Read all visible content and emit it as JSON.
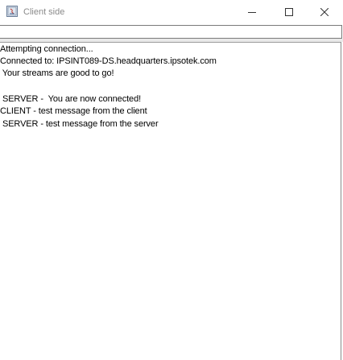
{
  "window": {
    "title": "Client side"
  },
  "input": {
    "value": "",
    "placeholder": ""
  },
  "chat": {
    "lines": [
      "Attempting connection...",
      "Connected to: IPSINT089-DS.headquarters.ipsotek.com",
      " Your streams are good to go!",
      "",
      " SERVER -  You are now connected!",
      "CLIENT - test message from the client",
      " SERVER - test message from the server"
    ]
  },
  "icons": {
    "app": "java-window-icon",
    "minimize": "minimize-icon",
    "maximize": "maximize-icon",
    "close": "close-icon"
  }
}
